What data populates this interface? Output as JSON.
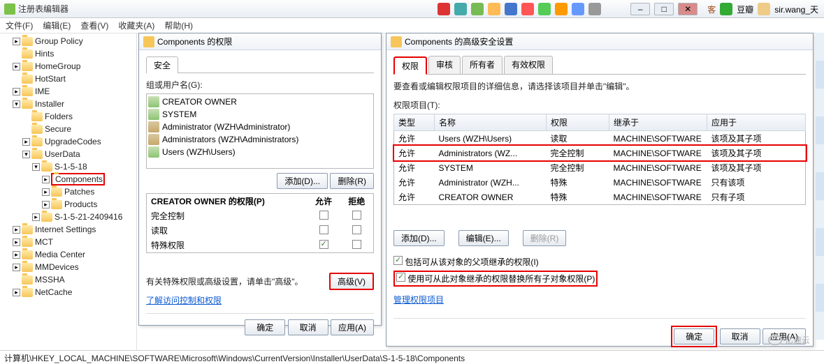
{
  "window": {
    "title": "注册表编辑器"
  },
  "tray": {
    "sirwang": "sir.wang_天",
    "douban": "豆瓣"
  },
  "menu": {
    "file": "文件(F)",
    "edit": "编辑(E)",
    "view": "查看(V)",
    "fav": "收藏夹(A)",
    "help": "帮助(H)"
  },
  "tree": [
    {
      "lvl": 1,
      "exp": ">",
      "label": "Group Policy"
    },
    {
      "lvl": 1,
      "exp": "",
      "label": "Hints"
    },
    {
      "lvl": 1,
      "exp": ">",
      "label": "HomeGroup"
    },
    {
      "lvl": 1,
      "exp": "",
      "label": "HotStart"
    },
    {
      "lvl": 1,
      "exp": ">",
      "label": "IME"
    },
    {
      "lvl": 1,
      "exp": "v",
      "label": "Installer"
    },
    {
      "lvl": 2,
      "exp": "",
      "label": "Folders"
    },
    {
      "lvl": 2,
      "exp": "",
      "label": "Secure"
    },
    {
      "lvl": 2,
      "exp": ">",
      "label": "UpgradeCodes"
    },
    {
      "lvl": 2,
      "exp": "v",
      "label": "UserData"
    },
    {
      "lvl": 3,
      "exp": "v",
      "label": "S-1-5-18"
    },
    {
      "lvl": 4,
      "exp": ">",
      "label": "Components",
      "hl": true
    },
    {
      "lvl": 4,
      "exp": ">",
      "label": "Patches"
    },
    {
      "lvl": 4,
      "exp": ">",
      "label": "Products"
    },
    {
      "lvl": 3,
      "exp": ">",
      "label": "S-1-5-21-2409416"
    },
    {
      "lvl": 1,
      "exp": ">",
      "label": "Internet Settings"
    },
    {
      "lvl": 1,
      "exp": ">",
      "label": "MCT"
    },
    {
      "lvl": 1,
      "exp": ">",
      "label": "Media Center"
    },
    {
      "lvl": 1,
      "exp": ">",
      "label": "MMDevices"
    },
    {
      "lvl": 1,
      "exp": "",
      "label": "MSSHA"
    },
    {
      "lvl": 1,
      "exp": ">",
      "label": "NetCache"
    }
  ],
  "dlg1": {
    "title": "Components 的权限",
    "tab_security": "安全",
    "group_label": "组或用户名(G):",
    "users": [
      "CREATOR OWNER",
      "SYSTEM",
      "Administrator (WZH\\Administrator)",
      "Administrators (WZH\\Administrators)",
      "Users (WZH\\Users)"
    ],
    "btn_add": "添加(D)...",
    "btn_remove": "删除(R)",
    "perm_for": "CREATOR OWNER 的权限(P)",
    "col_allow": "允许",
    "col_deny": "拒绝",
    "perms": [
      {
        "name": "完全控制",
        "allow": false,
        "deny": false
      },
      {
        "name": "读取",
        "allow": false,
        "deny": false
      },
      {
        "name": "特殊权限",
        "allow": true,
        "deny": false
      }
    ],
    "adv_text": "有关特殊权限或高级设置，请单击\"高级\"。",
    "btn_adv": "高级(V)",
    "link": "了解访问控制和权限",
    "ok": "确定",
    "cancel": "取消",
    "apply": "应用(A)"
  },
  "dlg2": {
    "title": "Components 的高级安全设置",
    "tabs": {
      "perm": "权限",
      "audit": "审核",
      "owner": "所有者",
      "eff": "有效权限"
    },
    "info": "要查看或编辑权限项目的详细信息，请选择该项目并单击\"编辑\"。",
    "list_label": "权限项目(T):",
    "cols": {
      "type": "类型",
      "name": "名称",
      "perm": "权限",
      "inh": "继承于",
      "apply": "应用于"
    },
    "rows": [
      {
        "type": "允许",
        "name": "Users (WZH\\Users)",
        "perm": "读取",
        "inh": "MACHINE\\SOFTWARE",
        "apply": "该项及其子项"
      },
      {
        "type": "允许",
        "name": "Administrators (WZ...",
        "perm": "完全控制",
        "inh": "MACHINE\\SOFTWARE",
        "apply": "该项及其子项",
        "hl": true
      },
      {
        "type": "允许",
        "name": "SYSTEM",
        "perm": "完全控制",
        "inh": "MACHINE\\SOFTWARE",
        "apply": "该项及其子项"
      },
      {
        "type": "允许",
        "name": "Administrator (WZH...",
        "perm": "特殊",
        "inh": "MACHINE\\SOFTWARE",
        "apply": "只有该项"
      },
      {
        "type": "允许",
        "name": "CREATOR OWNER",
        "perm": "特殊",
        "inh": "MACHINE\\SOFTWARE",
        "apply": "只有子项"
      }
    ],
    "btn_add": "添加(D)...",
    "btn_edit": "编辑(E)...",
    "btn_remove": "删除(R)",
    "cb1": "包括可从该对象的父项继承的权限(I)",
    "cb2": "使用可从此对象继承的权限替换所有子对象权限(P)",
    "link": "管理权限项目",
    "ok": "确定",
    "cancel": "取消",
    "apply": "应用(A)"
  },
  "status": "计算机\\HKEY_LOCAL_MACHINE\\SOFTWARE\\Microsoft\\Windows\\CurrentVersion\\Installer\\UserData\\S-1-5-18\\Components",
  "brand": "亿速云"
}
